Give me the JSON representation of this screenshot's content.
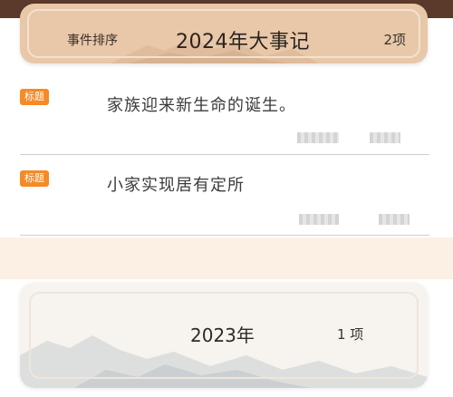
{
  "current_year": {
    "sort_label": "事件排序",
    "title": "2024年大事记",
    "count": "2项"
  },
  "events": [
    {
      "badge": "标题",
      "text": "家族迎来新生命的诞生。"
    },
    {
      "badge": "标题",
      "text": "小家实现居有定所"
    }
  ],
  "previous_year": {
    "title": "2023年",
    "count": "1 项"
  },
  "colors": {
    "badge": "#f58a26",
    "header_card": "#e8c8a8",
    "peach_band": "#fcefe3",
    "top_strip": "#5b3a2b"
  }
}
